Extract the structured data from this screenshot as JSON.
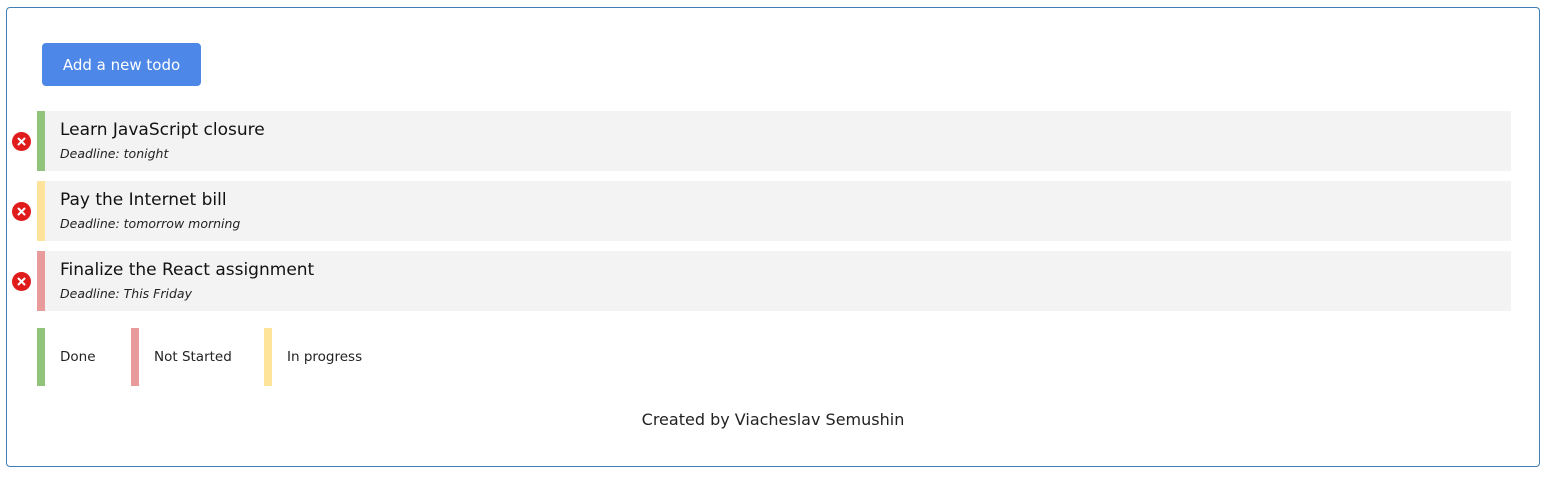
{
  "toolbar": {
    "add_label": "Add a new todo"
  },
  "todos": [
    {
      "title": "Learn JavaScript closure",
      "deadline": "Deadline: tonight",
      "status": "done"
    },
    {
      "title": "Pay the Internet bill",
      "deadline": "Deadline: tomorrow morning",
      "status": "in-progress"
    },
    {
      "title": "Finalize the React assignment",
      "deadline": "Deadline: This Friday",
      "status": "not-started"
    }
  ],
  "legend": {
    "done": "Done",
    "not_started": "Not Started",
    "in_progress": "In progress"
  },
  "footer": {
    "credit": "Created by Viacheslav Semushin"
  },
  "colors": {
    "primary_button": "#4d87e8",
    "done": "#8fc47a",
    "in_progress": "#fde49a",
    "not_started": "#e99a9a",
    "delete": "#e01b1b",
    "card_background": "#f3f3f3",
    "frame_border": "#3f7fb5"
  },
  "icons": {
    "delete": "close-circle-icon"
  }
}
